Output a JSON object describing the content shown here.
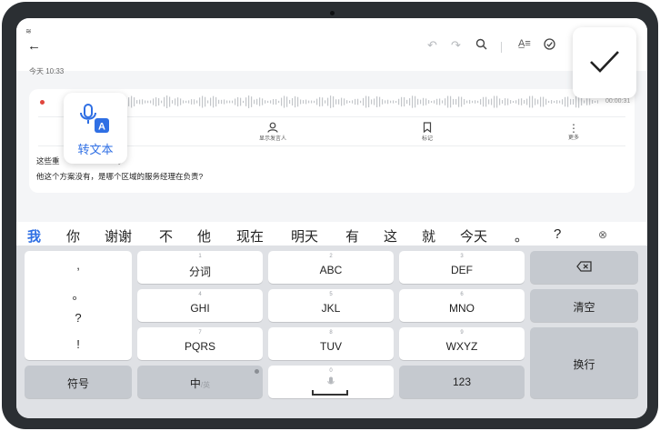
{
  "header": {
    "back_icon": "arrow-left-icon",
    "date": "今天 10:33",
    "tools": [
      "undo-icon",
      "redo-icon",
      "search-icon",
      "text-format-icon",
      "checklist-icon"
    ]
  },
  "confirm_button": {
    "icon": "check-icon"
  },
  "recording": {
    "time_right": "00:00:31",
    "actions": [
      {
        "icon": "person-icon",
        "label": "显示发言人"
      },
      {
        "icon": "bookmark-icon",
        "label": "标记"
      },
      {
        "icon": "more-icon",
        "label": "更多"
      }
    ],
    "text_line1": "这些重",
    "text_line1_tail": "。",
    "text_line2": "他这个方案没有，是哪个区域的服务经理在负责?"
  },
  "transcribe_popup": {
    "icon": "voice-to-text-icon",
    "label": "转文本"
  },
  "candidates": [
    "我",
    "你",
    "谢谢",
    "不",
    "他",
    "现在",
    "明天",
    "有",
    "这",
    "就",
    "今天",
    "。",
    "?"
  ],
  "keyboard": {
    "punctuation": [
      ",",
      "。",
      "?",
      "!"
    ],
    "keys": [
      {
        "num": "1",
        "label": "分词"
      },
      {
        "num": "2",
        "label": "ABC"
      },
      {
        "num": "3",
        "label": "DEF"
      },
      {
        "num": "4",
        "label": "GHI"
      },
      {
        "num": "5",
        "label": "JKL"
      },
      {
        "num": "6",
        "label": "MNO"
      },
      {
        "num": "7",
        "label": "PQRS"
      },
      {
        "num": "8",
        "label": "TUV"
      },
      {
        "num": "9",
        "label": "WXYZ"
      }
    ],
    "backspace_icon": "backspace-icon",
    "clear": "清空",
    "enter": "换行",
    "symbols": "符号",
    "lang_main": "中",
    "lang_alt": "/英",
    "space_num": "0",
    "mic_icon": "microphone-icon",
    "numbers": "123"
  }
}
